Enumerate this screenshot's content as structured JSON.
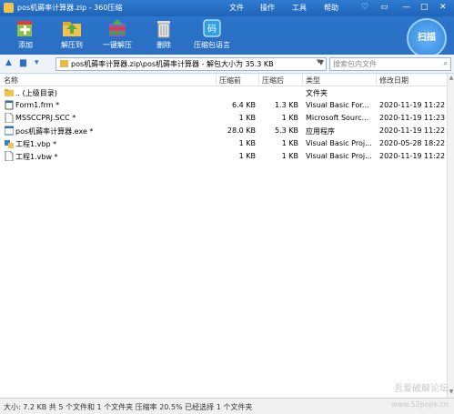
{
  "window": {
    "title": "pos机薅率计算器.zip - 360压缩",
    "menus": [
      "文件",
      "操作",
      "工具",
      "帮助"
    ]
  },
  "toolbar": {
    "buttons": [
      {
        "label": "添加",
        "icon": "add-icon"
      },
      {
        "label": "解压到",
        "icon": "extract-to-icon"
      },
      {
        "label": "一键解压",
        "icon": "one-click-extract-icon"
      },
      {
        "label": "删除",
        "icon": "delete-icon"
      },
      {
        "label": "压缩包语言",
        "icon": "archive-language-icon"
      }
    ],
    "scan_label": "扫描",
    "lang_glyph": "码"
  },
  "address": {
    "path": "pos机薅率计算器.zip\\pos机薅率计算器 - 解包大小为 35.3 KB",
    "search_placeholder": "搜索包内文件"
  },
  "columns": [
    "名称",
    "压缩前",
    "压缩后",
    "类型",
    "修改日期"
  ],
  "files": [
    {
      "name": ".. (上级目录)",
      "before": "",
      "after": "",
      "type": "文件夹",
      "date": "",
      "icon": "folder-up-icon"
    },
    {
      "name": "Form1.frm *",
      "before": "6.4 KB",
      "after": "1.3 KB",
      "type": "Visual Basic For...",
      "date": "2020-11-19 11:22",
      "icon": "vb-form-icon"
    },
    {
      "name": "MSSCCPRJ.SCC *",
      "before": "1 KB",
      "after": "1 KB",
      "type": "Microsoft Sourc...",
      "date": "2020-11-19 11:23",
      "icon": "file-icon"
    },
    {
      "name": "pos机薅率计算器.exe *",
      "before": "28.0 KB",
      "after": "5.3 KB",
      "type": "应用程序",
      "date": "2020-11-19 11:22",
      "icon": "exe-icon"
    },
    {
      "name": "工程1.vbp *",
      "before": "1 KB",
      "after": "1 KB",
      "type": "Visual Basic Proj...",
      "date": "2020-05-28 18:22",
      "icon": "vb-project-icon"
    },
    {
      "name": "工程1.vbw *",
      "before": "1 KB",
      "after": "1 KB",
      "type": "Visual Basic Proj...",
      "date": "2020-11-19 11:22",
      "icon": "file-icon"
    }
  ],
  "status": "大小: 7.2 KB 共 5 个文件和 1 个文件夹 压缩率 20.5% 已经选择 1 个文件夹",
  "watermark": {
    "line1": "吾爱破解论坛",
    "line2": "www.52pojie.cn"
  },
  "colors": {
    "titlebar": "#2f7bd0",
    "toolbar": "#2a74ca",
    "accent": "#2a6fc2"
  }
}
